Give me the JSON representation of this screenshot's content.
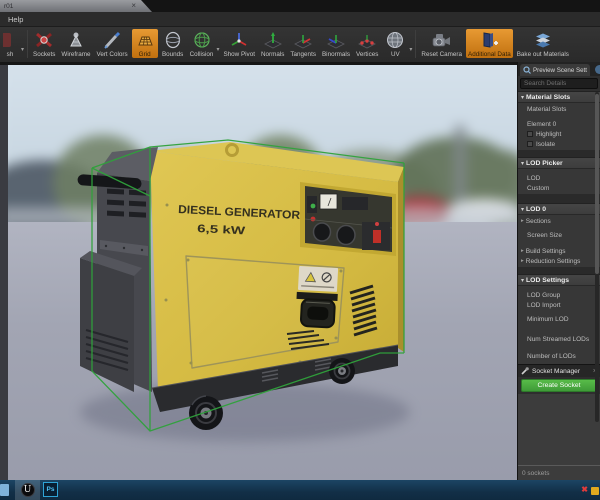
{
  "window": {
    "tab_title": "r01",
    "tab_close": "×",
    "menu_help": "Help"
  },
  "toolbar": {
    "items": [
      {
        "label": "sh"
      },
      {
        "label": "Sockets"
      },
      {
        "label": "Wireframe"
      },
      {
        "label": "Vert Colors"
      },
      {
        "label": "Grid",
        "active": true
      },
      {
        "label": "Bounds"
      },
      {
        "label": "Collision"
      },
      {
        "label": "Show Pivot"
      },
      {
        "label": "Normals"
      },
      {
        "label": "Tangents"
      },
      {
        "label": "Binormals"
      },
      {
        "label": "Vertices"
      },
      {
        "label": "UV"
      },
      {
        "label": "Reset Camera"
      },
      {
        "label": "Additional Data",
        "active": true
      },
      {
        "label": "Bake out Materials"
      }
    ]
  },
  "viewport": {
    "model_text_line1": "DIESEL GENERATOR",
    "model_text_line2": "6,5 kW"
  },
  "details": {
    "tab_label": "Preview Scene Sett",
    "search_placeholder": "Search Details",
    "material_slots": {
      "title": "Material Slots",
      "row": "Material Slots",
      "element": "Element 0",
      "checkbox1": "Highlight",
      "checkbox2": "Isolate"
    },
    "lod_picker": {
      "title": "LOD Picker",
      "row1": "LOD",
      "row2": "Custom"
    },
    "lod0": {
      "title": "LOD 0",
      "row1": "Sections",
      "row2": "Screen Size",
      "row3": "Build Settings",
      "row4": "Reduction Settings"
    },
    "lod_settings": {
      "title": "LOD Settings",
      "row1": "LOD Group",
      "row2": "LOD Import",
      "row3": "Minimum LOD",
      "row4": "Num Streamed LODs",
      "row5": "Number of LODs"
    },
    "socket_manager": {
      "title": "Socket Manager",
      "close_glyph": "×",
      "create_button": "Create Socket",
      "status": "0 sockets"
    }
  },
  "taskbar": {
    "unreal": "U",
    "photoshop": "Ps"
  },
  "colors": {
    "accent_orange": "#d8862a",
    "create_green": "#4caf50",
    "selection_wireframe_green": "#2fa23b",
    "generator_yellow": "#d7bd45",
    "taskbar_navy": "#16374f"
  }
}
